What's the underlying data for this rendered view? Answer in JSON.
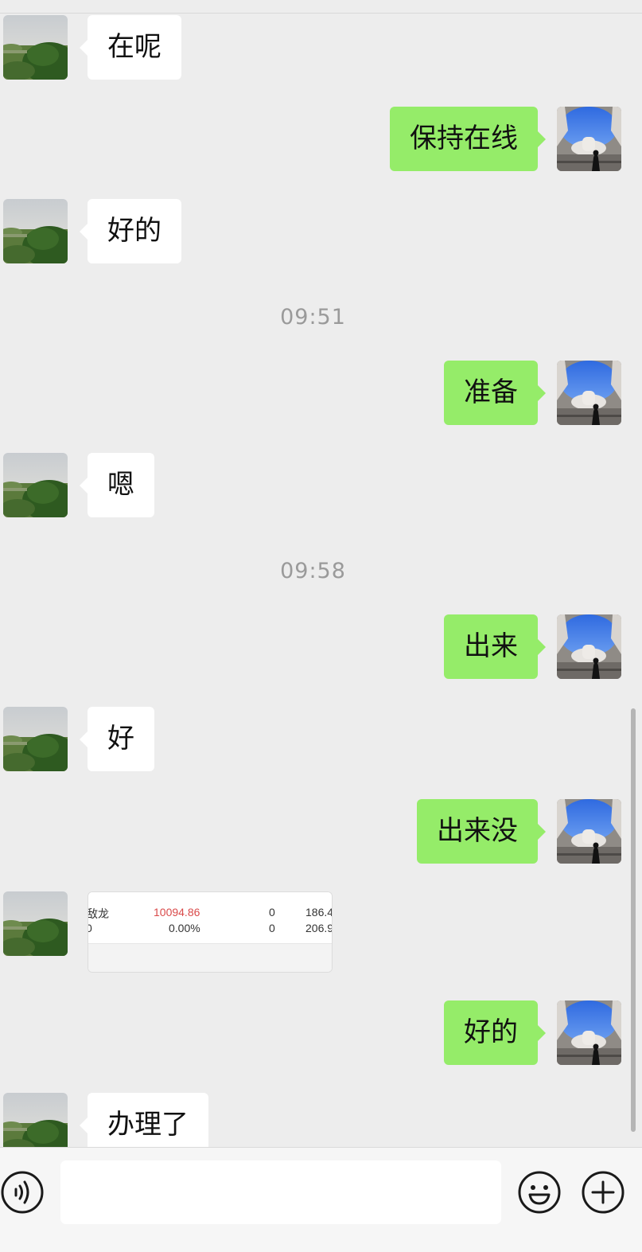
{
  "conversation": {
    "messages": [
      {
        "side": "in",
        "type": "text",
        "text": "在呢"
      },
      {
        "side": "out",
        "type": "text",
        "text": "保持在线"
      },
      {
        "side": "in",
        "type": "text",
        "text": "好的"
      },
      {
        "type": "time",
        "text": "09:51"
      },
      {
        "side": "out",
        "type": "text",
        "text": "准备"
      },
      {
        "side": "in",
        "type": "text",
        "text": "嗯"
      },
      {
        "type": "time",
        "text": "09:58"
      },
      {
        "side": "out",
        "type": "text",
        "text": "出来"
      },
      {
        "side": "in",
        "type": "text",
        "text": "好"
      },
      {
        "side": "out",
        "type": "text",
        "text": "出来没"
      },
      {
        "side": "in",
        "type": "image",
        "cells": {
          "r1c1": "敌龙",
          "r1c2": "10094.86",
          "r1c3": "0",
          "r1c4": "186.4",
          "r2c1": "0",
          "r2c2": "0.00%",
          "r2c3": "0",
          "r2c4": "206.9"
        }
      },
      {
        "side": "out",
        "type": "text",
        "text": "好的"
      },
      {
        "side": "in",
        "type": "text",
        "text": "办理了"
      }
    ]
  },
  "composer": {
    "input_value": "",
    "voice_icon": "voice-icon",
    "emoji_icon": "emoji-icon",
    "more_icon": "plus-icon"
  },
  "colors": {
    "background": "#ededed",
    "outgoing_bubble": "#95ec69",
    "incoming_bubble": "#ffffff",
    "timestamp_text": "#9a9a9a",
    "stock_red": "#d94a4a"
  }
}
